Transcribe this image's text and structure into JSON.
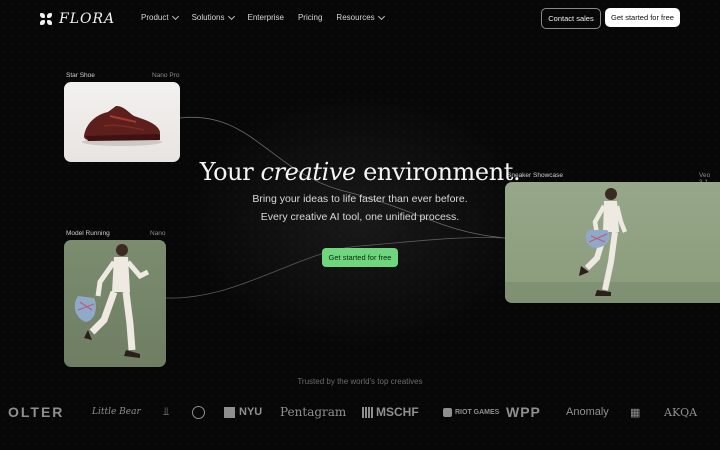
{
  "nav": {
    "brand": "FLORA",
    "menu": [
      {
        "label": "Product",
        "dropdown": true
      },
      {
        "label": "Solutions",
        "dropdown": true
      },
      {
        "label": "Enterprise",
        "dropdown": false
      },
      {
        "label": "Pricing",
        "dropdown": false
      },
      {
        "label": "Resources",
        "dropdown": true
      }
    ],
    "contact_sales": "Contact sales",
    "get_started": "Get started for free"
  },
  "cards": {
    "star_shoe": {
      "label": "Star Shoe",
      "model": "Nano Pro"
    },
    "model_running": {
      "label": "Model Running",
      "model": "Nano"
    },
    "sneaker_showcase": {
      "label": "Sneaker Showcase",
      "model": "Veo 3.1"
    }
  },
  "hero": {
    "title_before": "Your",
    "title_italic": "creative",
    "title_after": "environment.",
    "subtitle_line1": "Bring your ideas to life faster than ever before.",
    "subtitle_line2": "Every creative AI tool, one unified process.",
    "cta": "Get started for free"
  },
  "trusted": {
    "heading": "Trusted by the world's top creatives",
    "logos": [
      "OLTER",
      "Little Bear",
      "NYU",
      "Pentagram",
      "MSCHF",
      "RIOT GAMES",
      "WPP",
      "Anomaly",
      "AKQA"
    ]
  },
  "colors": {
    "background": "#070707",
    "cta_green": "#6fd67d"
  }
}
